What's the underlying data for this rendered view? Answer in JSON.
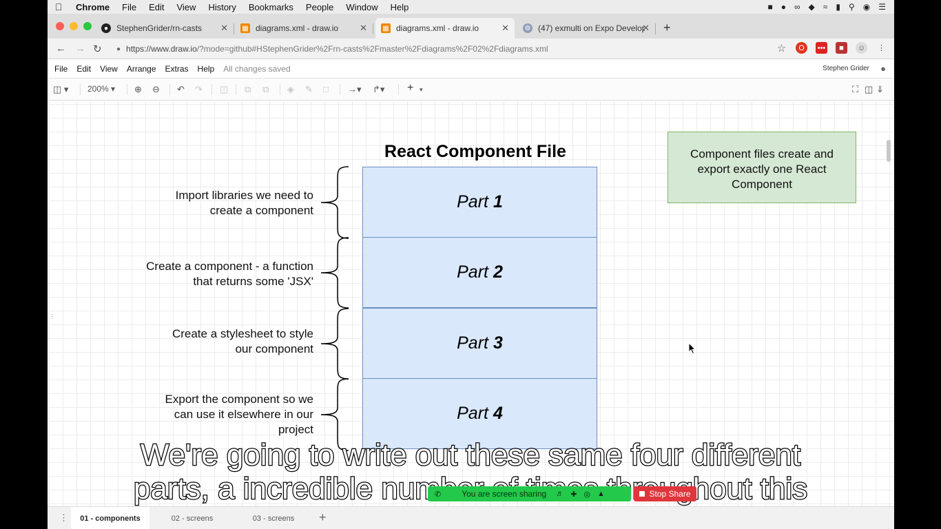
{
  "menubar": {
    "app": "Chrome",
    "items": [
      "File",
      "Edit",
      "View",
      "History",
      "Bookmarks",
      "People",
      "Window",
      "Help"
    ]
  },
  "tabs": [
    {
      "label": "StephenGrider/rn-casts",
      "icon": "github-icon"
    },
    {
      "label": "diagrams.xml - draw.io",
      "icon": "drawio-icon"
    },
    {
      "label": "diagrams.xml - draw.io",
      "icon": "drawio-icon"
    },
    {
      "label": "(47) exmulti on Expo Develope",
      "icon": "expo-icon"
    }
  ],
  "address": {
    "host": "https://www.draw.io",
    "path": "/?mode=github#HStephenGrider%2Frn-casts%2Fmaster%2Fdiagrams%2F02%2Fdiagrams.xml"
  },
  "drawio_menu": {
    "items": [
      "File",
      "Edit",
      "View",
      "Arrange",
      "Extras",
      "Help"
    ],
    "status": "All changes saved",
    "user": "Stephen Grider"
  },
  "toolbar": {
    "zoom": "200%"
  },
  "diagram": {
    "title": "React Component File",
    "parts": [
      {
        "prefix": "Part",
        "num": "1"
      },
      {
        "prefix": "Part",
        "num": "2"
      },
      {
        "prefix": "Part",
        "num": "3"
      },
      {
        "prefix": "Part",
        "num": "4"
      }
    ],
    "descriptions": [
      {
        "line1": "Import libraries we need to",
        "line2": "create a component",
        "line3": ""
      },
      {
        "line1": "Create a component - a function",
        "line2": "that returns some 'JSX'",
        "line3": ""
      },
      {
        "line1": "Create a stylesheet to style",
        "line2": "our component",
        "line3": ""
      },
      {
        "line1": "Export the component so we",
        "line2": "can use it elsewhere in our",
        "line3": "project"
      }
    ],
    "note": {
      "line1": "Component files create and",
      "line2": "export exactly one React",
      "line3": "Component"
    }
  },
  "page_tabs": {
    "items": [
      "01 - components",
      "02 - screens",
      "03 - screens"
    ],
    "active": 0
  },
  "captions": {
    "line1": "We're going to write out these same four different",
    "line2": "parts, a incredible number of times throughout this"
  },
  "share": {
    "status": "You are screen sharing",
    "stop": "Stop Share"
  },
  "colors": {
    "part_fill": "#dae8fc",
    "part_stroke": "#6c8ebf",
    "note_fill": "#d5e8d4",
    "note_stroke": "#82b366",
    "share_green": "#23c94a",
    "stop_red": "#e0353b"
  }
}
